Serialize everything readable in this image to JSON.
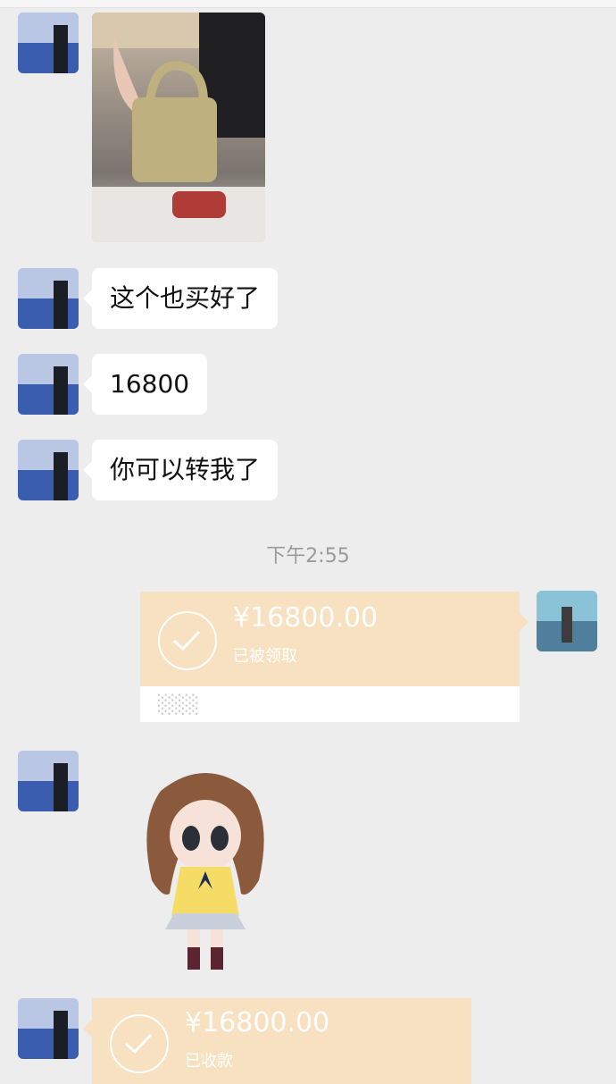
{
  "messages": {
    "m1": "这个也买好了",
    "m2": "16800",
    "m3": "你可以转我了"
  },
  "timestamp": "下午2:55",
  "transfer_sent": {
    "amount": "¥16800.00",
    "status": "已被领取",
    "note": "░░░"
  },
  "transfer_received": {
    "amount": "¥16800.00",
    "status": "已收款"
  },
  "colors": {
    "transfer_bg": "#f7e1c1",
    "chat_bg": "#ededed",
    "bubble_bg": "#ffffff"
  },
  "icons": {
    "check": "check-circle-icon",
    "sticker": "anime-girl-sticker",
    "photo": "handbag-photo"
  }
}
